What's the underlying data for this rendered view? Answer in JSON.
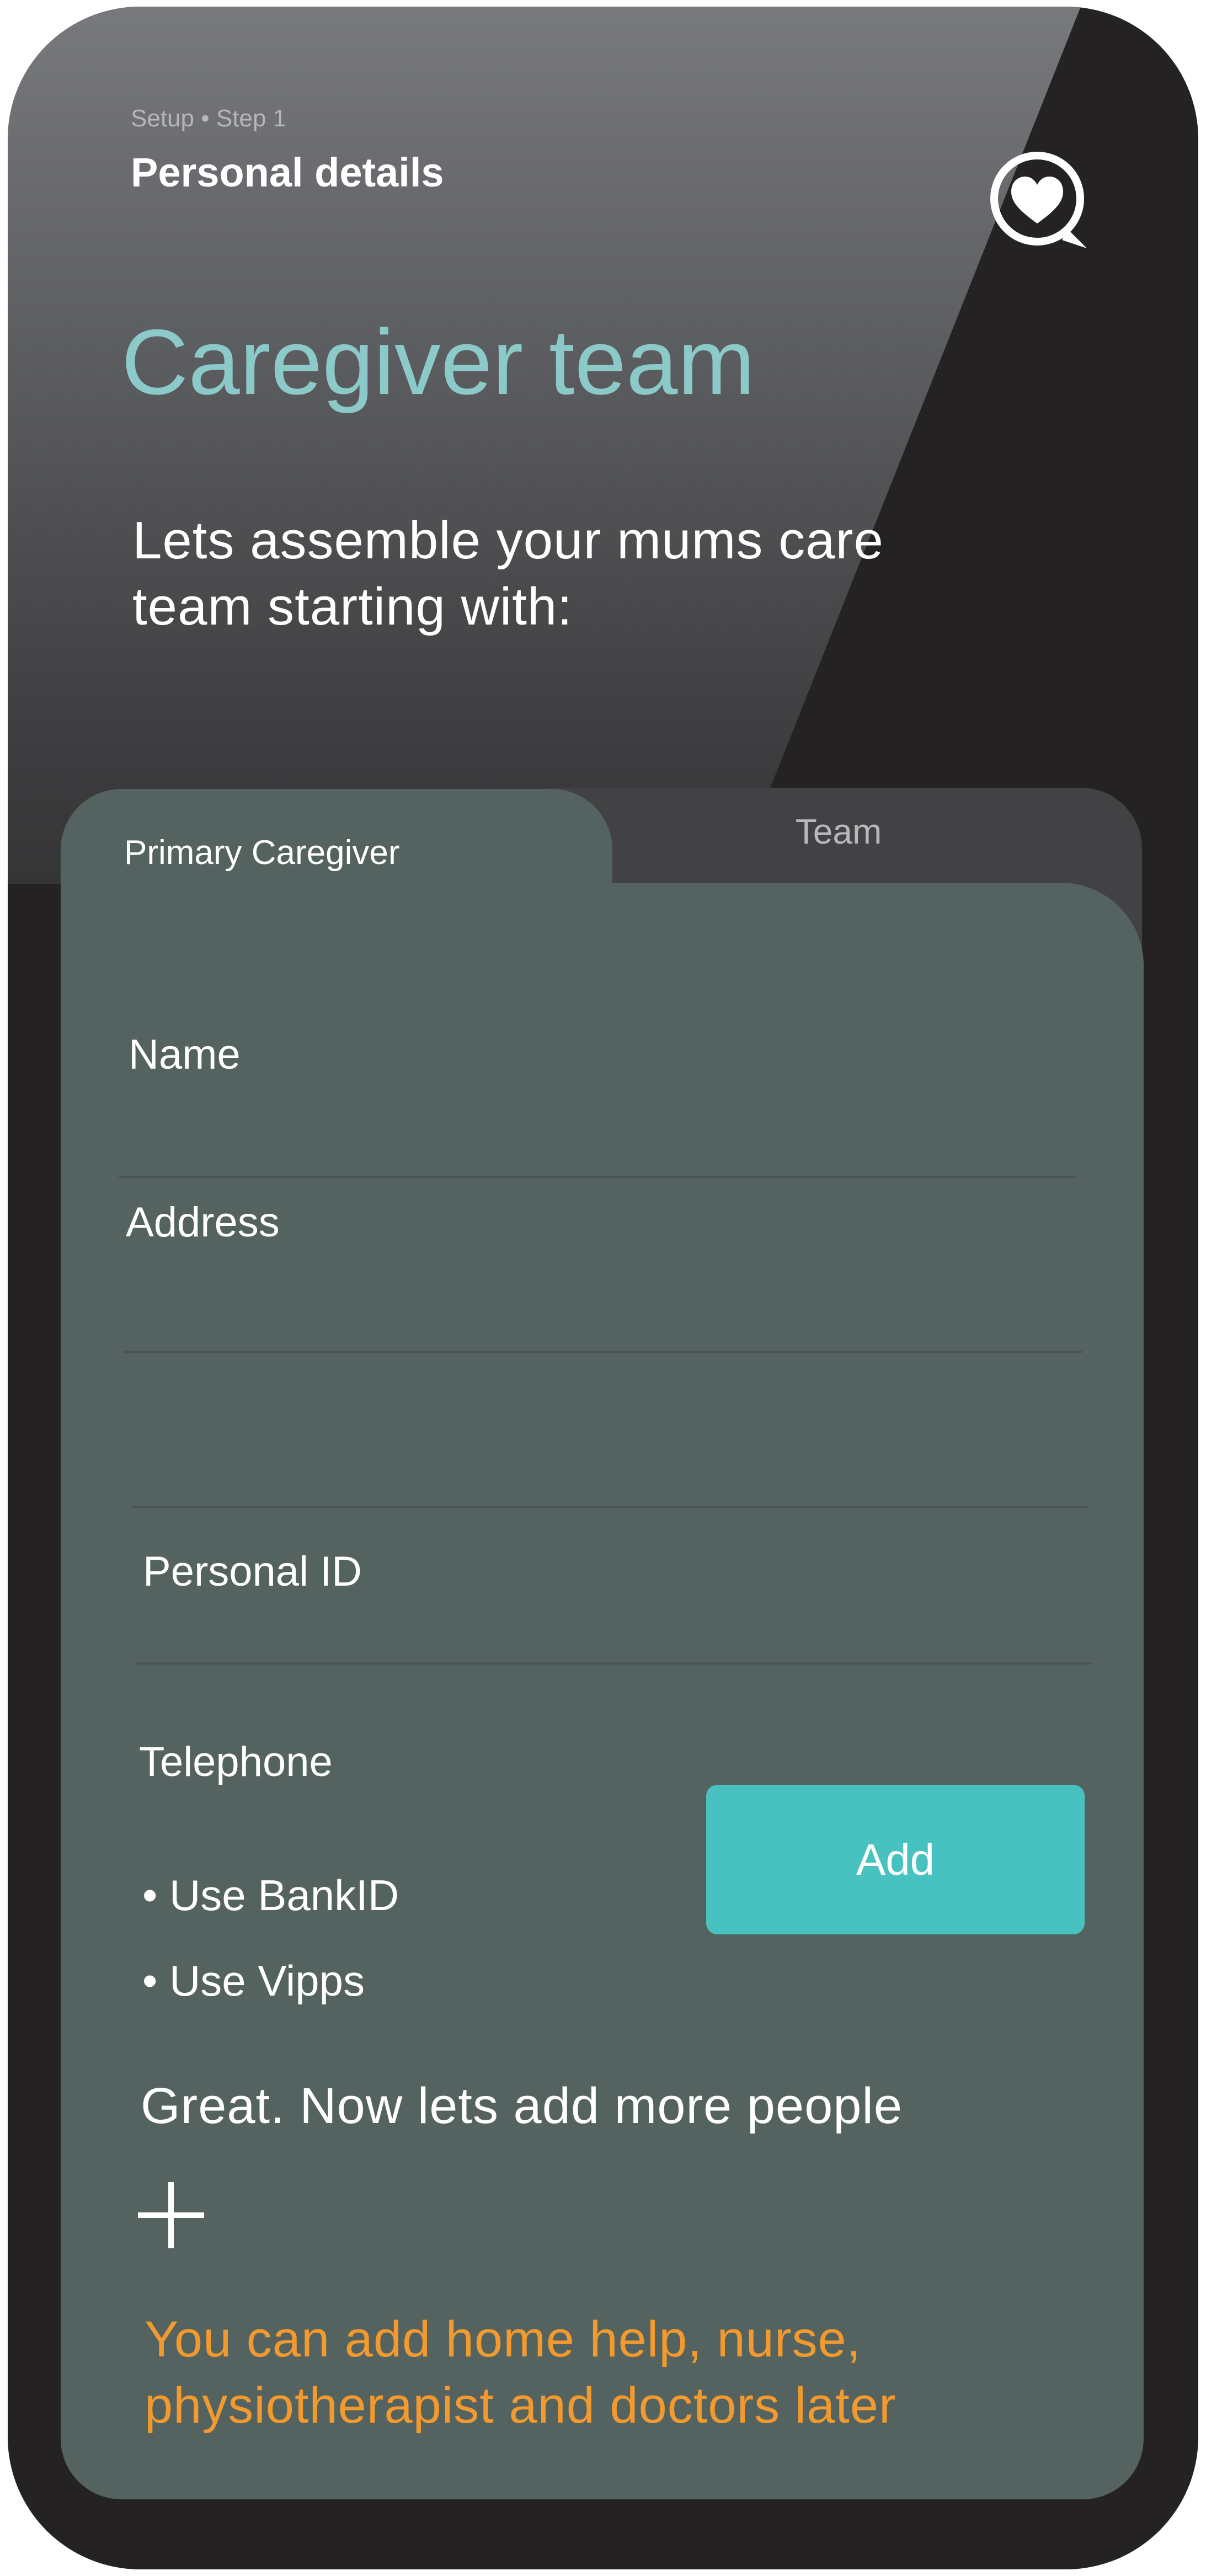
{
  "header": {
    "step_label": "Setup • Step 1",
    "step_title": "Personal details",
    "chat_icon": "heart-chat-icon"
  },
  "page": {
    "title": "Caregiver team",
    "intro": "Lets assemble your mums care team starting with:"
  },
  "tabs": [
    {
      "label": "Primary Caregiver",
      "active": true
    },
    {
      "label": "Team",
      "active": false
    }
  ],
  "form": {
    "name_label": "Name",
    "address_label": "Address",
    "personal_id_label": "Personal ID",
    "telephone_label": "Telephone",
    "methods": [
      "• Use BankID",
      "• Use Vipps"
    ],
    "add_button": "Add"
  },
  "footer": {
    "more_people": "Great. Now lets add more people",
    "hint": "You can add home help, nurse, physiotherapist and doctors later"
  },
  "colors": {
    "accent_teal": "#47c2c0",
    "title_teal": "#8bcac9",
    "hint_orange": "#f29a2e",
    "card_bg": "#556360",
    "phone_bg": "#252223"
  }
}
